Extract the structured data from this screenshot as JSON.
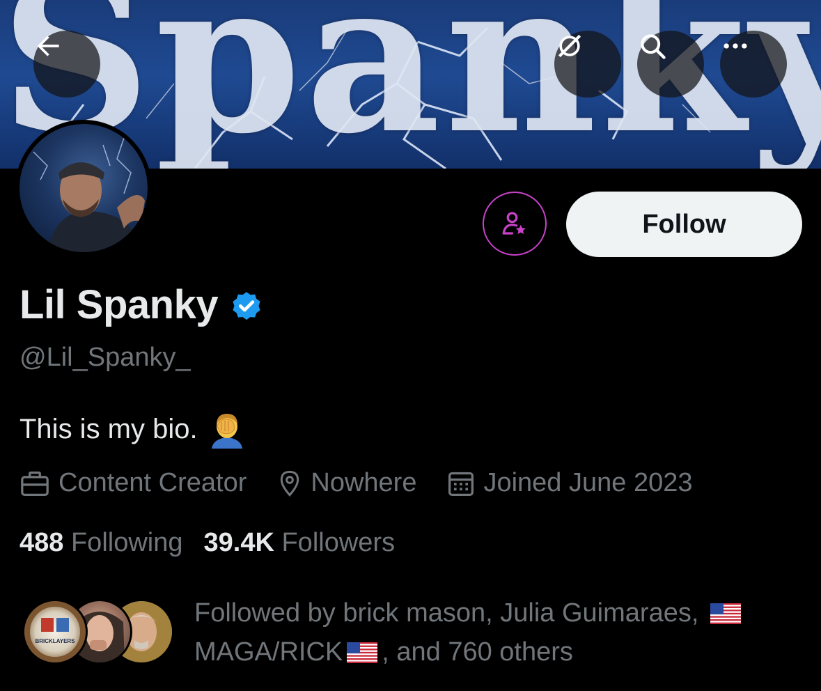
{
  "banner": {
    "text": "Spanky"
  },
  "header": {
    "back_icon": "arrow-left-icon",
    "grok_icon": "grok-icon",
    "search_icon": "search-icon",
    "more_icon": "ellipsis-icon"
  },
  "actions": {
    "subscribe_icon": "person-star-icon",
    "follow_label": "Follow"
  },
  "profile": {
    "display_name": "Lil Spanky",
    "handle": "@Lil_Spanky_",
    "verified": true,
    "bio": "This is my bio.",
    "bio_emoji": "facepalm-emoji",
    "profession": "Content Creator",
    "location": "Nowhere",
    "joined": "Joined June 2023"
  },
  "stats": {
    "following_count": "488",
    "following_label": "Following",
    "followers_count": "39.4K",
    "followers_label": "Followers"
  },
  "followed_by": {
    "line1": "Followed by brick mason, Julia Guimaraes,",
    "line2_name": "MAGA/RICK",
    "line2_rest": ", and 760 others",
    "avatar1_text": "BRICKLAYERS"
  },
  "colors": {
    "accent_purple": "#c942c9",
    "verified_blue": "#1d9bf0",
    "secondary_text": "#71767b",
    "primary_text": "#e7e9ea"
  }
}
